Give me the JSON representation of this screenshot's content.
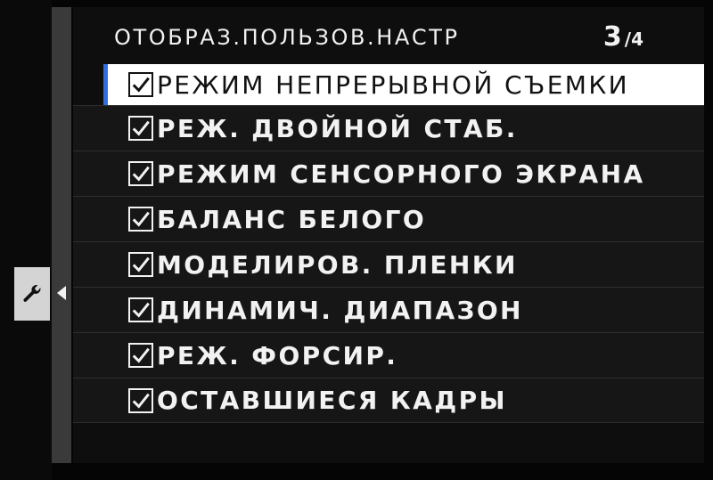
{
  "header": {
    "title": "ОТОБРАЗ.ПОЛЬЗОВ.НАСТР",
    "page_current": "3",
    "page_separator": "/",
    "page_total": "4"
  },
  "sidebar": {
    "active_tab_icon": "wrench-icon"
  },
  "items": [
    {
      "label": "РЕЖИМ НЕПРЕРЫВНОЙ СЪЕМКИ",
      "checked": true,
      "selected": true
    },
    {
      "label": "РЕЖ. ДВОЙНОЙ СТАБ.",
      "checked": true,
      "selected": false
    },
    {
      "label": "РЕЖИМ СЕНСОРНОГО ЭКРАНА",
      "checked": true,
      "selected": false
    },
    {
      "label": "БАЛАНС БЕЛОГО",
      "checked": true,
      "selected": false
    },
    {
      "label": "МОДЕЛИРОВ. ПЛЕНКИ",
      "checked": true,
      "selected": false
    },
    {
      "label": "ДИНАМИЧ. ДИАПАЗОН",
      "checked": true,
      "selected": false
    },
    {
      "label": "РЕЖ. ФОРСИР.",
      "checked": true,
      "selected": false
    },
    {
      "label": "ОСТАВШИЕСЯ КАДРЫ",
      "checked": true,
      "selected": false
    }
  ],
  "colors": {
    "selection_accent": "#2f6fe0",
    "selected_row_bg": "#ffffff",
    "text": "#f2f2f2"
  }
}
